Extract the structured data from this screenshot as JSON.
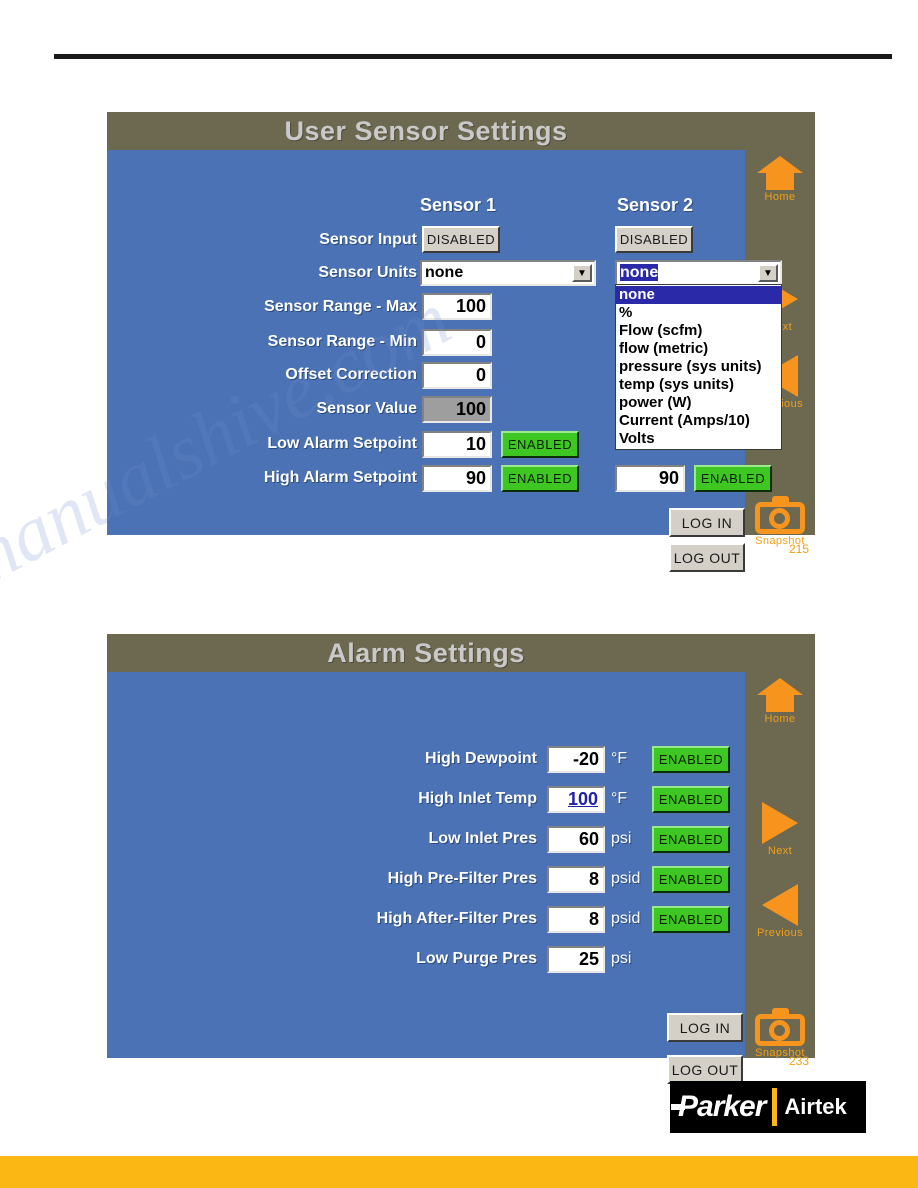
{
  "logo": {
    "brand": "Parker",
    "sub": "Airtek"
  },
  "watermark": "manualshive.com",
  "panel1": {
    "title": "User Sensor Settings",
    "page_number": "215",
    "column_headers": [
      "Sensor 1",
      "Sensor 2"
    ],
    "labels": {
      "sensor_input": "Sensor Input",
      "sensor_units": "Sensor Units",
      "range_max": "Sensor Range - Max",
      "range_min": "Sensor Range - Min",
      "offset_correction": "Offset Correction",
      "sensor_value": "Sensor Value",
      "low_alarm": "Low Alarm Setpoint",
      "high_alarm": "High Alarm Setpoint"
    },
    "sensor1": {
      "input_state": "DISABLED",
      "units": "none",
      "range_max": "100",
      "range_min": "0",
      "offset_correction": "0",
      "sensor_value": "100",
      "low_alarm_value": "10",
      "low_alarm_state": "ENABLED",
      "high_alarm_value": "90",
      "high_alarm_state": "ENABLED"
    },
    "sensor2": {
      "input_state": "DISABLED",
      "units": "none",
      "high_alarm_value": "90",
      "high_alarm_state": "ENABLED"
    },
    "units_dropdown_options": [
      "none",
      "%",
      "Flow (scfm)",
      "flow (metric)",
      "pressure (sys units)",
      "temp (sys units)",
      "power (W)",
      "Current (Amps/10)",
      "Volts"
    ],
    "units_dropdown_selected": "none",
    "nav": {
      "home": "Home",
      "next": "Next",
      "previous": "Previous",
      "snapshot": "Snapshot"
    },
    "auth": {
      "login": "LOG IN",
      "logout": "LOG OUT"
    }
  },
  "panel2": {
    "title": "Alarm Settings",
    "page_number": "233",
    "rows": [
      {
        "label": "High Dewpoint",
        "value": "-20",
        "unit": "°F",
        "state": "ENABLED",
        "selected": false,
        "has_toggle": true
      },
      {
        "label": "High Inlet Temp",
        "value": "100",
        "unit": "°F",
        "state": "ENABLED",
        "selected": true,
        "has_toggle": true
      },
      {
        "label": "Low Inlet Pres",
        "value": "60",
        "unit": "psi",
        "state": "ENABLED",
        "selected": false,
        "has_toggle": true
      },
      {
        "label": "High Pre-Filter Pres",
        "value": "8",
        "unit": "psid",
        "state": "ENABLED",
        "selected": false,
        "has_toggle": true
      },
      {
        "label": "High After-Filter Pres",
        "value": "8",
        "unit": "psid",
        "state": "ENABLED",
        "selected": false,
        "has_toggle": true
      },
      {
        "label": "Low Purge Pres",
        "value": "25",
        "unit": "psi",
        "state": "",
        "selected": false,
        "has_toggle": false
      }
    ],
    "nav": {
      "home": "Home",
      "next": "Next",
      "previous": "Previous",
      "snapshot": "Snapshot"
    },
    "auth": {
      "login": "LOG IN",
      "logout": "LOG OUT"
    }
  },
  "colors": {
    "panel_body": "#4a72b4",
    "panel_title": "#6d6850",
    "accent_orange": "#f7941e",
    "enabled_green": "#3ec722",
    "brand_yellow": "#fbb713"
  }
}
